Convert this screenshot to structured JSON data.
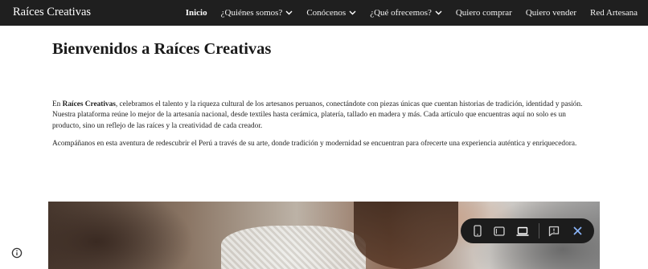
{
  "header": {
    "site_title": "Raíces Creativas",
    "nav": [
      {
        "label": "Inicio",
        "active": true,
        "dropdown": false
      },
      {
        "label": "¿Quiénes somos?",
        "active": false,
        "dropdown": true
      },
      {
        "label": "Conócenos",
        "active": false,
        "dropdown": true
      },
      {
        "label": "¿Qué ofrecemos?",
        "active": false,
        "dropdown": true
      },
      {
        "label": "Quiero comprar",
        "active": false,
        "dropdown": false
      },
      {
        "label": "Quiero vender",
        "active": false,
        "dropdown": false
      },
      {
        "label": "Red Artesana",
        "active": false,
        "dropdown": false
      }
    ]
  },
  "main": {
    "heading": "Bienvenidos a Raíces Creativas",
    "p1_prefix": "En ",
    "p1_brand": "Raíces Creativas",
    "p1_rest": ", celebramos el talento y la riqueza cultural de los artesanos peruanos, conectándote con piezas únicas que cuentan historias de tradición, identidad y pasión. Nuestra plataforma reúne lo mejor de la artesanía nacional, desde textiles hasta cerámica, platería, tallado en madera y más. Cada artículo que encuentras aquí no solo es un producto, sino un reflejo de las raíces y la creatividad de cada creador.",
    "p2": "Acompáñanos en esta aventura de redescubrir el Perú a través de su arte, donde tradición y modernidad se encuentran para ofrecerte una experiencia auténtica y enriquecedora."
  },
  "hero": {
    "icon": "hero-photo-knitting"
  },
  "preview_toolbar": {
    "buttons": [
      "phone-icon",
      "tablet-icon",
      "laptop-icon",
      "feedback-icon",
      "close-icon"
    ]
  },
  "colors": {
    "navbar_bg": "#1f1f1f",
    "toolbar_bg": "#1c1c1c",
    "close_accent": "#8ab4f8"
  }
}
